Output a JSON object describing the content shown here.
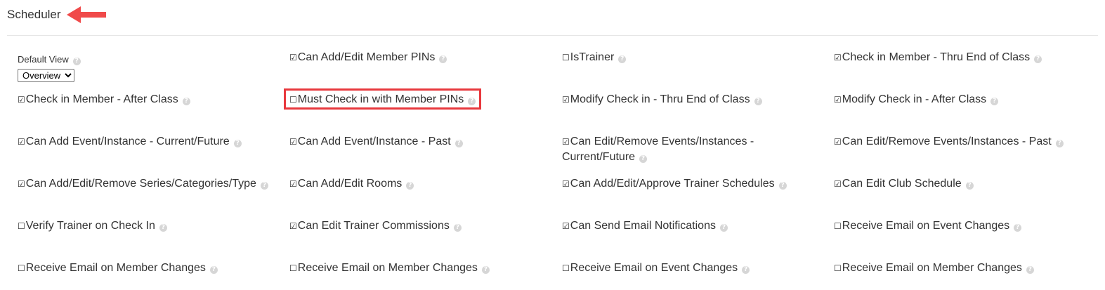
{
  "section": {
    "title": "Scheduler"
  },
  "default_view": {
    "label": "Default View",
    "selected": "Overview",
    "options": [
      "Overview"
    ]
  },
  "help_glyph": "?",
  "permissions": [
    {
      "label": "Can Add/Edit Member PINs",
      "checked": true
    },
    {
      "label": "IsTrainer",
      "checked": false
    },
    {
      "label": "Check in Member - Thru End of Class",
      "checked": true
    },
    {
      "label": "Check in Member - After Class",
      "checked": true
    },
    {
      "label": "Must Check in with Member PINs",
      "checked": false
    },
    {
      "label": "Modify Check in - Thru End of Class",
      "checked": true
    },
    {
      "label": "Modify Check in - After Class",
      "checked": true
    },
    {
      "label": "Can Add Event/Instance - Current/Future",
      "checked": true
    },
    {
      "label": "Can Add Event/Instance - Past",
      "checked": true
    },
    {
      "label": "Can Edit/Remove Events/Instances - Current/Future",
      "checked": true
    },
    {
      "label": "Can Edit/Remove Events/Instances - Past",
      "checked": true
    },
    {
      "label": "Can Add/Edit/Remove Series/Categories/Type",
      "checked": true
    },
    {
      "label": "Can Add/Edit Rooms",
      "checked": true
    },
    {
      "label": "Can Add/Edit/Approve Trainer Schedules",
      "checked": true
    },
    {
      "label": "Can Edit Club Schedule",
      "checked": true
    },
    {
      "label": "Verify Trainer on Check In",
      "checked": false
    },
    {
      "label": "Can Edit Trainer Commissions",
      "checked": true
    },
    {
      "label": "Can Send Email Notifications",
      "checked": true
    },
    {
      "label": "Receive Email on Event Changes",
      "checked": false
    },
    {
      "label": "Receive Email on Member Changes",
      "checked": false
    },
    {
      "label": "Receive Email on Member Changes",
      "checked": false
    },
    {
      "label": "Receive Email on Event Changes",
      "checked": false
    },
    {
      "label": "Receive Email on Member Changes",
      "checked": false
    }
  ],
  "colors": {
    "annotation_red": "#e8383d",
    "arrow_red": "#f04a4a"
  }
}
